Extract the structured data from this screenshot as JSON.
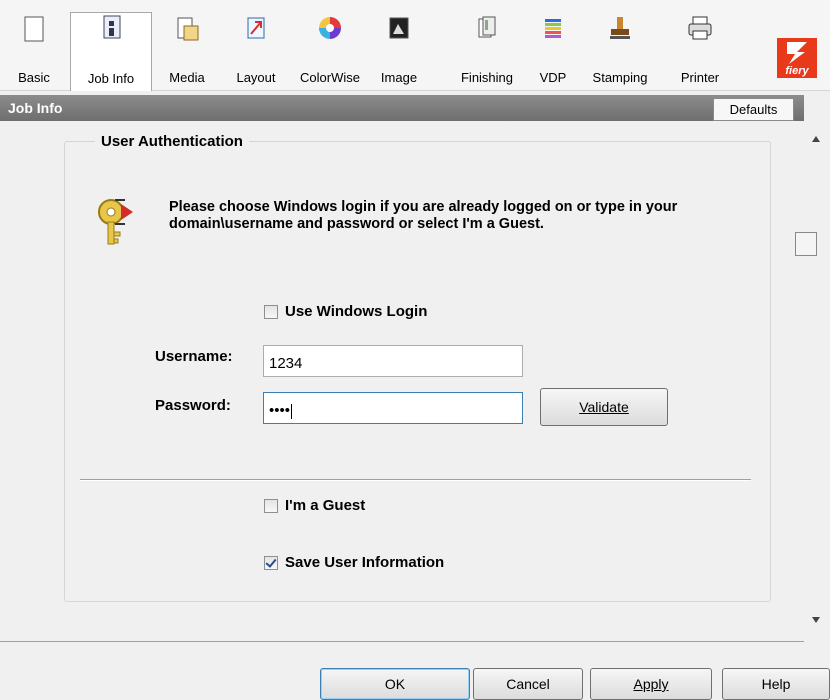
{
  "tabs": [
    {
      "label": "Basic",
      "icon": "basic-icon"
    },
    {
      "label": "Job Info",
      "icon": "job-info-icon",
      "active": true
    },
    {
      "label": "Media",
      "icon": "media-icon"
    },
    {
      "label": "Layout",
      "icon": "layout-icon"
    },
    {
      "label": "ColorWise",
      "icon": "colorwise-icon"
    },
    {
      "label": "Image",
      "icon": "image-icon"
    },
    {
      "label": "Finishing",
      "icon": "finishing-icon"
    },
    {
      "label": "VDP",
      "icon": "vdp-icon"
    },
    {
      "label": "Stamping",
      "icon": "stamping-icon"
    },
    {
      "label": "Printer",
      "icon": "printer-icon"
    }
  ],
  "logo": {
    "text": "fiery",
    "color": "#e8391a"
  },
  "section": {
    "title": "Job Info",
    "defaults_label": "Defaults"
  },
  "auth": {
    "group_title": "User Authentication",
    "info": "Please choose Windows login if you are already logged on or type in your domain\\username and password or select I'm a Guest.",
    "use_windows_login": {
      "label": "Use Windows Login",
      "checked": false
    },
    "username_label": "Username:",
    "username_value": "1234",
    "password_label": "Password:",
    "password_value": "••••",
    "validate_label": "Validate",
    "guest": {
      "label": "I'm a Guest",
      "checked": false
    },
    "save_info": {
      "label": "Save User Information",
      "checked": true
    }
  },
  "footer": {
    "ok": "OK",
    "cancel": "Cancel",
    "apply": "Apply",
    "help": "Help"
  }
}
